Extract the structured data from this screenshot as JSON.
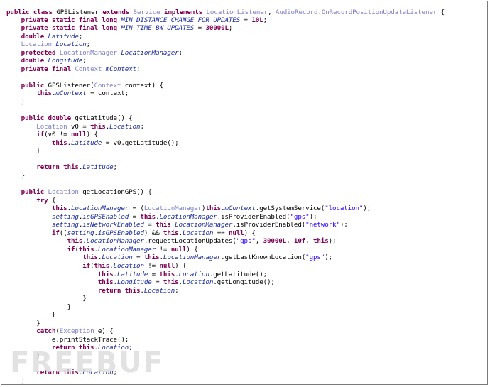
{
  "editor": {
    "language": "java",
    "lines": [
      [
        [
          "kw",
          "public"
        ],
        [
          "p",
          " "
        ],
        [
          "kw",
          "class"
        ],
        [
          "p",
          " GPSListener "
        ],
        [
          "kw",
          "extends"
        ],
        [
          "p",
          " "
        ],
        [
          "ty",
          "Service"
        ],
        [
          "p",
          " "
        ],
        [
          "kw",
          "implements"
        ],
        [
          "p",
          " "
        ],
        [
          "ty",
          "LocationListener"
        ],
        [
          "p",
          ", "
        ],
        [
          "ty",
          "AudioRecord.OnRecordPositionUpdateListener"
        ],
        [
          "p",
          " {"
        ]
      ],
      [
        [
          "p",
          "    "
        ],
        [
          "kw",
          "private static final long"
        ],
        [
          "p",
          " "
        ],
        [
          "fi",
          "MIN_DISTANCE_CHANGE_FOR_UPDATES"
        ],
        [
          "p",
          " = "
        ],
        [
          "kw",
          "10L"
        ],
        [
          "p",
          ";"
        ]
      ],
      [
        [
          "p",
          "    "
        ],
        [
          "kw",
          "private static final long"
        ],
        [
          "p",
          " "
        ],
        [
          "fi",
          "MIN_TIME_BW_UPDATES"
        ],
        [
          "p",
          " = "
        ],
        [
          "kw",
          "30000L"
        ],
        [
          "p",
          ";"
        ]
      ],
      [
        [
          "p",
          "    "
        ],
        [
          "kw",
          "double"
        ],
        [
          "p",
          " "
        ],
        [
          "fi",
          "Latitude"
        ],
        [
          "p",
          ";"
        ]
      ],
      [
        [
          "p",
          "    "
        ],
        [
          "ty",
          "Location"
        ],
        [
          "p",
          " "
        ],
        [
          "fi",
          "Location"
        ],
        [
          "p",
          ";"
        ]
      ],
      [
        [
          "p",
          "    "
        ],
        [
          "kw",
          "protected"
        ],
        [
          "p",
          " "
        ],
        [
          "ty",
          "LocationManager"
        ],
        [
          "p",
          " "
        ],
        [
          "fi",
          "LocationManager"
        ],
        [
          "p",
          ";"
        ]
      ],
      [
        [
          "p",
          "    "
        ],
        [
          "kw",
          "double"
        ],
        [
          "p",
          " "
        ],
        [
          "fi",
          "Longitude"
        ],
        [
          "p",
          ";"
        ]
      ],
      [
        [
          "p",
          "    "
        ],
        [
          "kw",
          "private final"
        ],
        [
          "p",
          " "
        ],
        [
          "ty",
          "Context"
        ],
        [
          "p",
          " "
        ],
        [
          "fi",
          "mContext"
        ],
        [
          "p",
          ";"
        ]
      ],
      [
        [
          "p",
          ""
        ]
      ],
      [
        [
          "p",
          "    "
        ],
        [
          "kw",
          "public"
        ],
        [
          "p",
          " GPSListener("
        ],
        [
          "ty",
          "Context"
        ],
        [
          "p",
          " context) {"
        ]
      ],
      [
        [
          "p",
          "        "
        ],
        [
          "kw",
          "this"
        ],
        [
          "p",
          "."
        ],
        [
          "fi",
          "mContext"
        ],
        [
          "p",
          " = context;"
        ]
      ],
      [
        [
          "p",
          "    }"
        ]
      ],
      [
        [
          "p",
          ""
        ]
      ],
      [
        [
          "p",
          "    "
        ],
        [
          "kw",
          "public double"
        ],
        [
          "p",
          " getLatitude() {"
        ]
      ],
      [
        [
          "p",
          "        "
        ],
        [
          "ty",
          "Location"
        ],
        [
          "p",
          " v0 = "
        ],
        [
          "kw",
          "this"
        ],
        [
          "p",
          "."
        ],
        [
          "fi",
          "Location"
        ],
        [
          "p",
          ";"
        ]
      ],
      [
        [
          "p",
          "        "
        ],
        [
          "kw",
          "if"
        ],
        [
          "p",
          "(v0 != "
        ],
        [
          "kw",
          "null"
        ],
        [
          "p",
          ") {"
        ]
      ],
      [
        [
          "p",
          "            "
        ],
        [
          "kw",
          "this"
        ],
        [
          "p",
          "."
        ],
        [
          "fi",
          "Latitude"
        ],
        [
          "p",
          " = v0.getLatitude();"
        ]
      ],
      [
        [
          "p",
          "        }"
        ]
      ],
      [
        [
          "p",
          ""
        ]
      ],
      [
        [
          "p",
          "        "
        ],
        [
          "kw",
          "return this"
        ],
        [
          "p",
          "."
        ],
        [
          "fi",
          "Latitude"
        ],
        [
          "p",
          ";"
        ]
      ],
      [
        [
          "p",
          "    }"
        ]
      ],
      [
        [
          "p",
          ""
        ]
      ],
      [
        [
          "p",
          "    "
        ],
        [
          "kw",
          "public"
        ],
        [
          "p",
          " "
        ],
        [
          "ty",
          "Location"
        ],
        [
          "p",
          " getLocationGPS() {"
        ]
      ],
      [
        [
          "p",
          "        "
        ],
        [
          "kw",
          "try"
        ],
        [
          "p",
          " {"
        ]
      ],
      [
        [
          "p",
          "            "
        ],
        [
          "kw",
          "this"
        ],
        [
          "p",
          "."
        ],
        [
          "fi",
          "LocationManager"
        ],
        [
          "p",
          " = ("
        ],
        [
          "ty",
          "LocationManager"
        ],
        [
          "p",
          ")"
        ],
        [
          "kw",
          "this"
        ],
        [
          "p",
          "."
        ],
        [
          "fi",
          "mContext"
        ],
        [
          "p",
          ".getSystemService("
        ],
        [
          "st",
          "\"location\""
        ],
        [
          "p",
          ");"
        ]
      ],
      [
        [
          "p",
          "            "
        ],
        [
          "fi",
          "setting"
        ],
        [
          "p",
          "."
        ],
        [
          "fi",
          "isGPSEnabled"
        ],
        [
          "p",
          " = "
        ],
        [
          "kw",
          "this"
        ],
        [
          "p",
          "."
        ],
        [
          "fi",
          "LocationManager"
        ],
        [
          "p",
          ".isProviderEnabled("
        ],
        [
          "st",
          "\"gps\""
        ],
        [
          "p",
          ");"
        ]
      ],
      [
        [
          "p",
          "            "
        ],
        [
          "fi",
          "setting"
        ],
        [
          "p",
          "."
        ],
        [
          "fi",
          "isNetworkEnabled"
        ],
        [
          "p",
          " = "
        ],
        [
          "kw",
          "this"
        ],
        [
          "p",
          "."
        ],
        [
          "fi",
          "LocationManager"
        ],
        [
          "p",
          ".isProviderEnabled("
        ],
        [
          "st",
          "\"network\""
        ],
        [
          "p",
          ");"
        ]
      ],
      [
        [
          "p",
          "            "
        ],
        [
          "kw",
          "if"
        ],
        [
          "p",
          "(("
        ],
        [
          "fi",
          "setting"
        ],
        [
          "p",
          "."
        ],
        [
          "fi",
          "isGPSEnabled"
        ],
        [
          "p",
          ") && "
        ],
        [
          "kw",
          "this"
        ],
        [
          "p",
          "."
        ],
        [
          "fi",
          "Location"
        ],
        [
          "p",
          " == "
        ],
        [
          "kw",
          "null"
        ],
        [
          "p",
          ") {"
        ]
      ],
      [
        [
          "p",
          "                "
        ],
        [
          "kw",
          "this"
        ],
        [
          "p",
          "."
        ],
        [
          "fi",
          "LocationManager"
        ],
        [
          "p",
          ".requestLocationUpdates("
        ],
        [
          "st",
          "\"gps\""
        ],
        [
          "p",
          ", "
        ],
        [
          "kw",
          "30000L"
        ],
        [
          "p",
          ", "
        ],
        [
          "kw",
          "10f"
        ],
        [
          "p",
          ", "
        ],
        [
          "kw",
          "this"
        ],
        [
          "p",
          ");"
        ]
      ],
      [
        [
          "p",
          "                "
        ],
        [
          "kw",
          "if"
        ],
        [
          "p",
          "("
        ],
        [
          "kw",
          "this"
        ],
        [
          "p",
          "."
        ],
        [
          "fi",
          "LocationManager"
        ],
        [
          "p",
          " != "
        ],
        [
          "kw",
          "null"
        ],
        [
          "p",
          ") {"
        ]
      ],
      [
        [
          "p",
          "                    "
        ],
        [
          "kw",
          "this"
        ],
        [
          "p",
          "."
        ],
        [
          "fi",
          "Location"
        ],
        [
          "p",
          " = "
        ],
        [
          "kw",
          "this"
        ],
        [
          "p",
          "."
        ],
        [
          "fi",
          "LocationManager"
        ],
        [
          "p",
          ".getLastKnownLocation("
        ],
        [
          "st",
          "\"gps\""
        ],
        [
          "p",
          ");"
        ]
      ],
      [
        [
          "p",
          "                    "
        ],
        [
          "kw",
          "if"
        ],
        [
          "p",
          "("
        ],
        [
          "kw",
          "this"
        ],
        [
          "p",
          "."
        ],
        [
          "fi",
          "Location"
        ],
        [
          "p",
          " != "
        ],
        [
          "kw",
          "null"
        ],
        [
          "p",
          ") {"
        ]
      ],
      [
        [
          "p",
          "                        "
        ],
        [
          "kw",
          "this"
        ],
        [
          "p",
          "."
        ],
        [
          "fi",
          "Latitude"
        ],
        [
          "p",
          " = "
        ],
        [
          "kw",
          "this"
        ],
        [
          "p",
          "."
        ],
        [
          "fi",
          "Location"
        ],
        [
          "p",
          ".getLatitude();"
        ]
      ],
      [
        [
          "p",
          "                        "
        ],
        [
          "kw",
          "this"
        ],
        [
          "p",
          "."
        ],
        [
          "fi",
          "Longitude"
        ],
        [
          "p",
          " = "
        ],
        [
          "kw",
          "this"
        ],
        [
          "p",
          "."
        ],
        [
          "fi",
          "Location"
        ],
        [
          "p",
          ".getLongitude();"
        ]
      ],
      [
        [
          "p",
          "                        "
        ],
        [
          "kw",
          "return this"
        ],
        [
          "p",
          "."
        ],
        [
          "fi",
          "Location"
        ],
        [
          "p",
          ";"
        ]
      ],
      [
        [
          "p",
          "                    }"
        ]
      ],
      [
        [
          "p",
          "                }"
        ]
      ],
      [
        [
          "p",
          "            }"
        ]
      ],
      [
        [
          "p",
          "        }"
        ]
      ],
      [
        [
          "p",
          "        "
        ],
        [
          "kw",
          "catch"
        ],
        [
          "p",
          "("
        ],
        [
          "ty",
          "Exception"
        ],
        [
          "p",
          " e) {"
        ]
      ],
      [
        [
          "p",
          "            e.printStackTrace();"
        ]
      ],
      [
        [
          "p",
          "            "
        ],
        [
          "kw",
          "return this"
        ],
        [
          "p",
          "."
        ],
        [
          "fi",
          "Location"
        ],
        [
          "p",
          ";"
        ]
      ],
      [
        [
          "p",
          "        }"
        ]
      ],
      [
        [
          "p",
          ""
        ]
      ],
      [
        [
          "p",
          "        "
        ],
        [
          "kw",
          "return this"
        ],
        [
          "p",
          "."
        ],
        [
          "fi",
          "Location"
        ],
        [
          "p",
          ";"
        ]
      ],
      [
        [
          "p",
          "    }"
        ]
      ]
    ]
  },
  "watermark": {
    "text": "FREEBUF"
  }
}
